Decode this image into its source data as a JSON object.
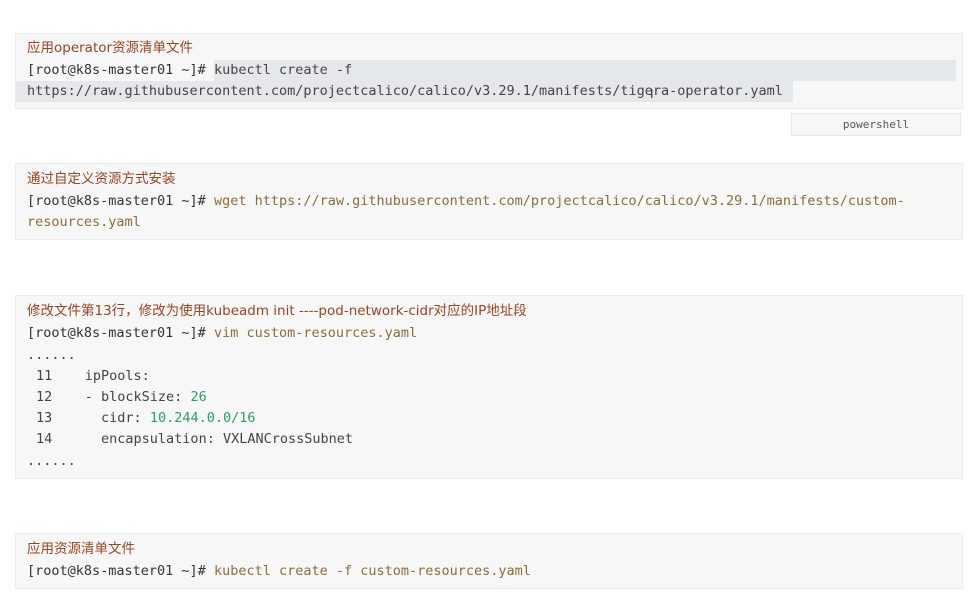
{
  "blocks": [
    {
      "comment": "应用operator资源清单文件",
      "prompt": "[root@k8s-master01 ~]#",
      "command": " kubectl create -f",
      "continuation": "https://raw.githubusercontent.com/projectcalico/calico/v3.29.1/manifests/tigera-operator.yaml"
    },
    {
      "comment": "通过自定义资源方式安装",
      "prompt": "[root@k8s-master01 ~]#",
      "command": " wget https://raw.githubusercontent.com/projectcalico/calico/v3.29.1/manifests/custom-",
      "continuation": "resources.yaml"
    },
    {
      "comment": "修改文件第13行，修改为使用kubeadm init ----pod-network-cidr对应的IP地址段",
      "prompt": "[root@k8s-master01 ~]#",
      "command": " vim custom-resources.yaml",
      "ellipsis_top": "......",
      "lines": [
        {
          "no": "11",
          "text": "    ipPools:",
          "value": ""
        },
        {
          "no": "12",
          "text": "    - blockSize: ",
          "value": "26"
        },
        {
          "no": "13",
          "text": "      cidr: ",
          "value": "10.244.0.0/16"
        },
        {
          "no": "14",
          "text": "      encapsulation: VXLANCrossSubnet",
          "value": ""
        }
      ],
      "ellipsis_bottom": "......"
    },
    {
      "comment": "应用资源清单文件",
      "prompt": "[root@k8s-master01 ~]#",
      "command": " kubectl create -f custom-resources.yaml"
    }
  ],
  "language_tag": "powershell",
  "cursor_glyph": "I"
}
